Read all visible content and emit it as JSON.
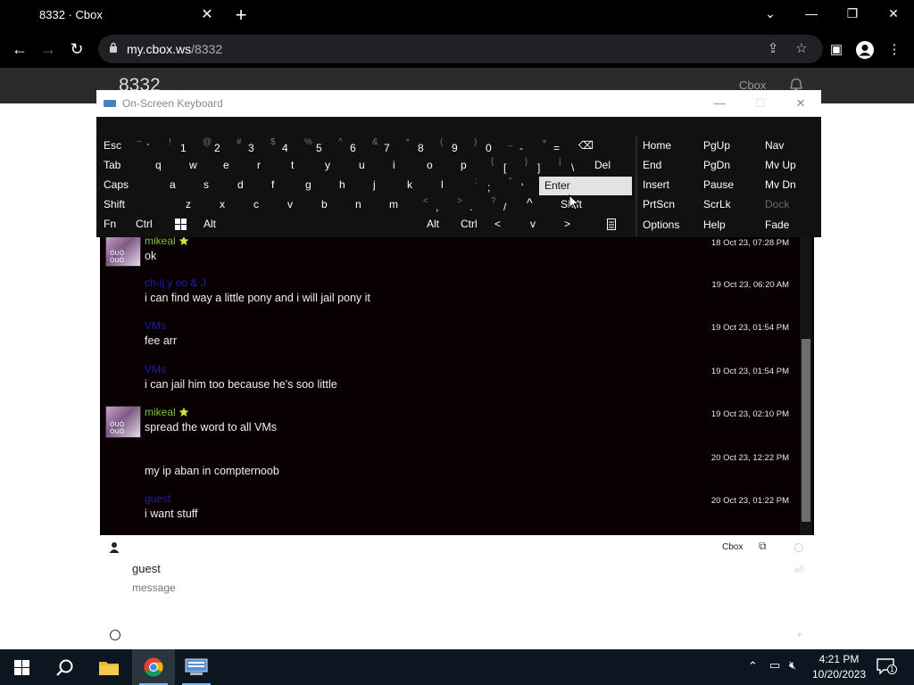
{
  "browser": {
    "tab_title": "8332 · Cbox",
    "url_host": "my.cbox.ws",
    "url_path": "/8332"
  },
  "page": {
    "title": "8332",
    "brand": "Cbox"
  },
  "messages": [
    {
      "name": "mikeal",
      "name_color": "green",
      "starred": true,
      "text": "ok",
      "time": "18 Oct 23, 07:28 PM",
      "has_avatar": true
    },
    {
      "name": "ch-ij y oo & J",
      "name_color": "blue",
      "starred": false,
      "text": "i can find way a little pony and i will jail pony it",
      "time": "19 Oct 23, 06:20 AM",
      "has_avatar": false
    },
    {
      "name": "VMs",
      "name_color": "blue",
      "starred": false,
      "text": "fee arr",
      "time": "19 Oct 23, 01:54 PM",
      "has_avatar": false
    },
    {
      "name": "VMs",
      "name_color": "blue",
      "starred": false,
      "text": "i can jail him too because he's soo little",
      "time": "19 Oct 23, 01:54 PM",
      "has_avatar": false
    },
    {
      "name": "mikeal",
      "name_color": "green",
      "starred": true,
      "text": "spread the word to all VMs",
      "time": "19 Oct 23, 02:10 PM",
      "has_avatar": true
    },
    {
      "name": "",
      "name_color": "blue",
      "starred": false,
      "text": "my ip aban in compternoob",
      "time": "20 Oct 23, 12:22 PM",
      "has_avatar": false
    },
    {
      "name": "guest",
      "name_color": "blue",
      "starred": false,
      "text": "i want stuff",
      "time": "20 Oct 23, 01:22 PM",
      "has_avatar": false
    }
  ],
  "avatar_caption": "ÓUÒ ÒUÓ",
  "compose": {
    "cbox_link": "Cbox",
    "name_value": "guest",
    "message_placeholder": "message"
  },
  "osk": {
    "title": "On-Screen Keyboard",
    "row1": [
      {
        "label": "Esc"
      },
      {
        "sub": "~",
        "main": "`"
      },
      {
        "sub": "!",
        "main": "1"
      },
      {
        "sub": "@",
        "main": "2"
      },
      {
        "sub": "#",
        "main": "3"
      },
      {
        "sub": "$",
        "main": "4"
      },
      {
        "sub": "%",
        "main": "5"
      },
      {
        "sub": "^",
        "main": "6"
      },
      {
        "sub": "&",
        "main": "7"
      },
      {
        "sub": "*",
        "main": "8"
      },
      {
        "sub": "(",
        "main": "9"
      },
      {
        "sub": ")",
        "main": "0"
      },
      {
        "sub": "_",
        "main": "-"
      },
      {
        "sub": "+",
        "main": "="
      },
      {
        "label": "⌫"
      }
    ],
    "row2": [
      "Tab",
      "q",
      "w",
      "e",
      "r",
      "t",
      "y",
      "u",
      "i",
      "o",
      "p"
    ],
    "row2_brackets": [
      {
        "sub": "{",
        "main": "["
      },
      {
        "sub": "}",
        "main": "]"
      },
      {
        "sub": "|",
        "main": "\\"
      }
    ],
    "row2_del": "Del",
    "row3": [
      "Caps",
      "a",
      "s",
      "d",
      "f",
      "g",
      "h",
      "j",
      "k",
      "l"
    ],
    "row3_punct": [
      {
        "sub": ":",
        "main": ";"
      },
      {
        "sub": "\"",
        "main": "'"
      }
    ],
    "row3_enter": "Enter",
    "row4": [
      "Shift",
      "z",
      "x",
      "c",
      "v",
      "b",
      "n",
      "m"
    ],
    "row4_punct": [
      {
        "sub": "<",
        "main": ","
      },
      {
        "sub": ">",
        "main": "."
      },
      {
        "sub": "?",
        "main": "/"
      }
    ],
    "row4_up": "^",
    "row4_shift": "Shift",
    "row5_left": [
      "Fn",
      "Ctrl"
    ],
    "row5_alt": "Alt",
    "row5_right": [
      "Alt",
      "Ctrl"
    ],
    "row5_arrows": [
      "<",
      "v",
      ">"
    ],
    "nav_col1": [
      "Home",
      "End",
      "Insert",
      "PrtScn",
      "Options"
    ],
    "nav_col2": [
      "PgUp",
      "PgDn",
      "Pause",
      "ScrLk",
      "Help"
    ],
    "nav_col3": [
      "Nav",
      "Mv Up",
      "Mv Dn",
      "Dock",
      "Fade"
    ]
  },
  "taskbar": {
    "time": "4:21 PM",
    "date": "10/20/2023",
    "notification_count": "1"
  },
  "colors": {
    "name_green": "#7ec242",
    "name_blue": "#1c1cb8",
    "chat_bg": "#080001",
    "osk_bg": "#111111",
    "taskbar_bg": "#0b1621"
  },
  "icons": [
    "lock-icon",
    "share-icon",
    "star-icon",
    "sidebar-icon",
    "profile-icon",
    "menu-icon",
    "bell-icon",
    "user-icon",
    "popout-icon",
    "smiley-icon",
    "keyboard-icon",
    "windows-icon",
    "search-icon",
    "folder-icon",
    "chrome-icon",
    "notification-icon"
  ]
}
